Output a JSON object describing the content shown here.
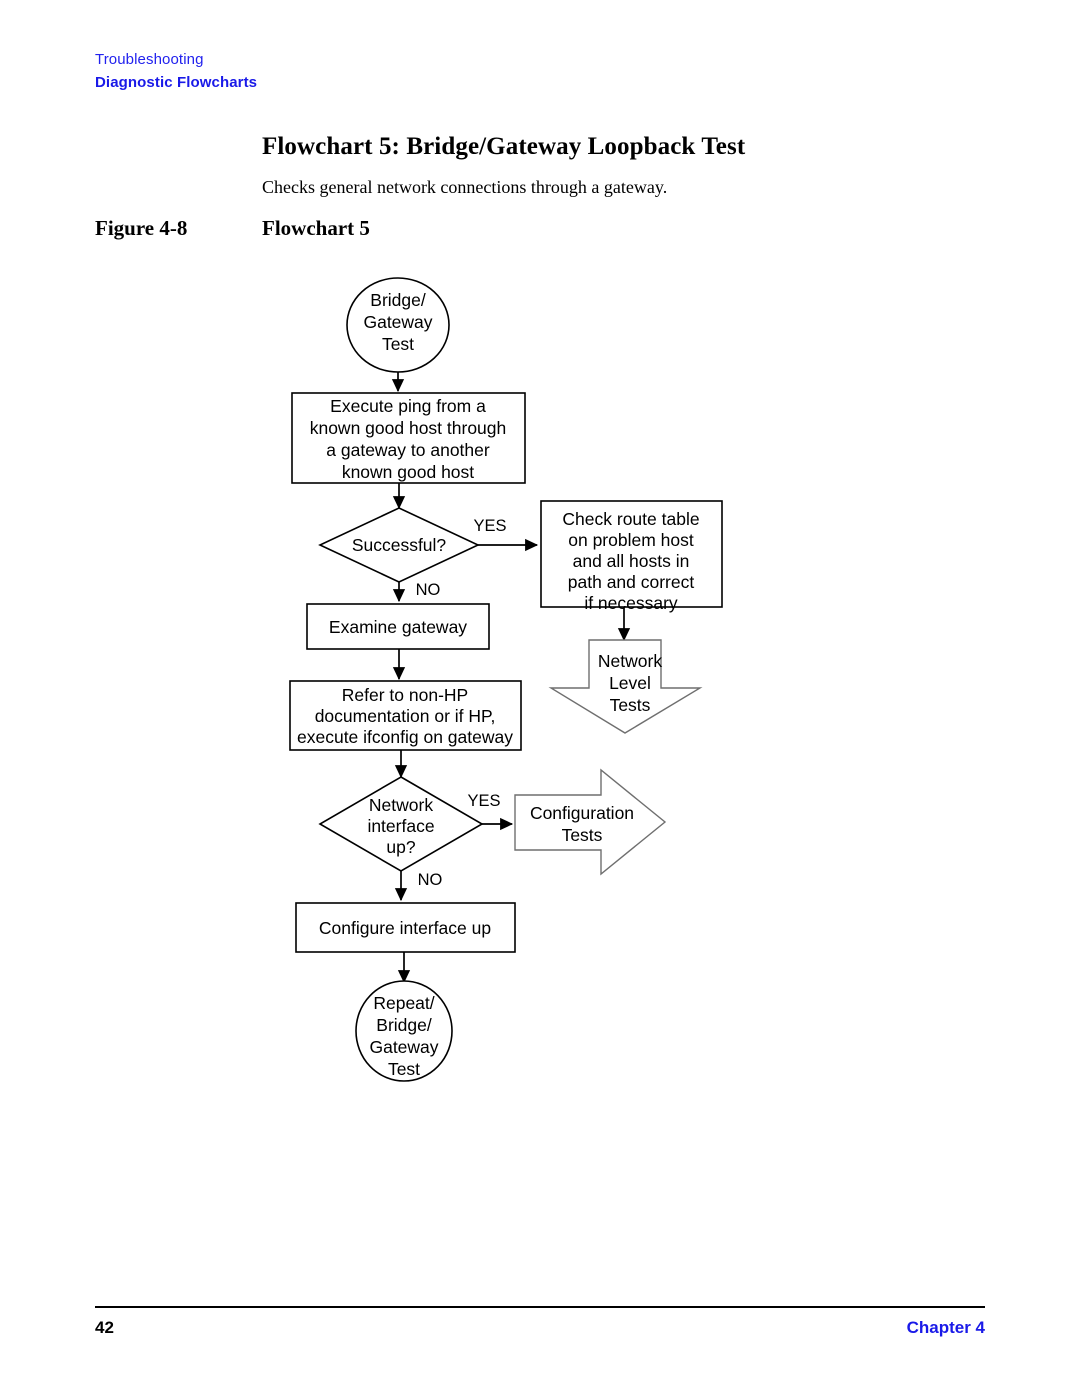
{
  "runhead": {
    "chapter_label": "Troubleshooting",
    "section_label": "Diagnostic Flowcharts"
  },
  "heading": {
    "title": "Flowchart 5: Bridge/Gateway Loopback Test",
    "subtitle": "Checks general network connections through a gateway."
  },
  "figure": {
    "number": "Figure 4-8",
    "caption": "Flowchart 5"
  },
  "footer": {
    "page_number": "42",
    "chapter": "Chapter 4"
  },
  "chart_data": {
    "type": "diagram",
    "title": "Flowchart 5",
    "nodes": [
      {
        "id": "start",
        "shape": "ellipse",
        "lines": [
          "Bridge/",
          "Gateway",
          "Test"
        ]
      },
      {
        "id": "ping",
        "shape": "process",
        "lines": [
          "Execute ping from a",
          "known good host through",
          "a gateway to another",
          "known good host"
        ]
      },
      {
        "id": "successful",
        "shape": "decision",
        "lines": [
          "Successful?"
        ]
      },
      {
        "id": "route",
        "shape": "process",
        "lines": [
          "Check route table",
          "on problem host",
          "and all hosts in",
          "path and correct",
          "if necessary"
        ]
      },
      {
        "id": "netlevel",
        "shape": "arrow-down",
        "lines": [
          "Network",
          "Level",
          "Tests"
        ]
      },
      {
        "id": "examine",
        "shape": "process",
        "lines": [
          "Examine gateway"
        ]
      },
      {
        "id": "refer",
        "shape": "process",
        "lines": [
          "Refer to non-HP",
          "documentation or if HP,",
          "execute ifconfig on gateway"
        ]
      },
      {
        "id": "ifup",
        "shape": "decision",
        "lines": [
          "Network",
          "interface",
          "up?"
        ]
      },
      {
        "id": "configtests",
        "shape": "arrow-right",
        "lines": [
          "Configuration",
          "Tests"
        ]
      },
      {
        "id": "configure",
        "shape": "process",
        "lines": [
          "Configure interface up"
        ]
      },
      {
        "id": "repeat",
        "shape": "ellipse",
        "lines": [
          "Repeat/",
          "Bridge/",
          "Gateway",
          "Test"
        ]
      }
    ],
    "edges": [
      {
        "from": "start",
        "to": "ping",
        "label": ""
      },
      {
        "from": "ping",
        "to": "successful",
        "label": ""
      },
      {
        "from": "successful",
        "to": "route",
        "label": "YES"
      },
      {
        "from": "successful",
        "to": "examine",
        "label": "NO"
      },
      {
        "from": "route",
        "to": "netlevel",
        "label": ""
      },
      {
        "from": "examine",
        "to": "refer",
        "label": ""
      },
      {
        "from": "refer",
        "to": "ifup",
        "label": ""
      },
      {
        "from": "ifup",
        "to": "configtests",
        "label": "YES"
      },
      {
        "from": "ifup",
        "to": "configure",
        "label": "NO"
      },
      {
        "from": "configure",
        "to": "repeat",
        "label": ""
      }
    ],
    "edge_labels": {
      "yes_1": "YES",
      "no_1": "NO",
      "yes_2": "YES",
      "no_2": "NO"
    }
  }
}
